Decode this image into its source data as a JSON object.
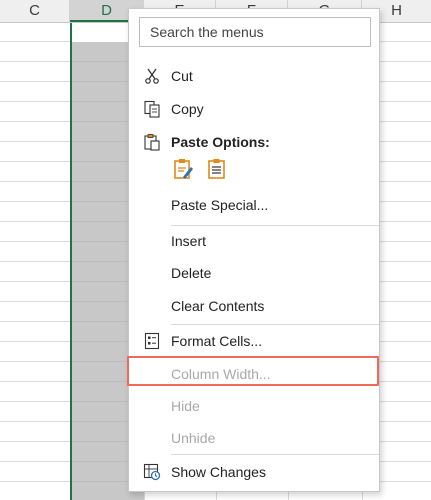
{
  "columns": [
    "C",
    "D",
    "E",
    "F",
    "G",
    "H"
  ],
  "selected_column": "D",
  "menu": {
    "search_placeholder": "Search the menus",
    "items": [
      {
        "label": "Cut",
        "icon": "scissors-icon",
        "enabled": true
      },
      {
        "label": "Copy",
        "icon": "copy-icon",
        "enabled": true
      },
      {
        "label": "Paste Options:",
        "icon": "paste-icon",
        "enabled": true,
        "bold": true
      },
      {
        "label": "Paste Special...",
        "icon": "",
        "enabled": true
      },
      {
        "label": "Insert",
        "icon": "",
        "enabled": true
      },
      {
        "label": "Delete",
        "icon": "",
        "enabled": true
      },
      {
        "label": "Clear Contents",
        "icon": "",
        "enabled": true
      },
      {
        "label": "Format Cells...",
        "icon": "format-cells-icon",
        "enabled": true
      },
      {
        "label": "Column Width...",
        "icon": "",
        "enabled": false,
        "highlighted": true
      },
      {
        "label": "Hide",
        "icon": "",
        "enabled": false
      },
      {
        "label": "Unhide",
        "icon": "",
        "enabled": false
      },
      {
        "label": "Show Changes",
        "icon": "show-changes-icon",
        "enabled": true
      }
    ],
    "paste_option_icons": [
      "paste-formatting-icon",
      "paste-values-icon"
    ]
  },
  "colors": {
    "selection_border": "#217346",
    "highlight_box": "#f06a5b",
    "paste_icon_orange": "#e08a18"
  }
}
